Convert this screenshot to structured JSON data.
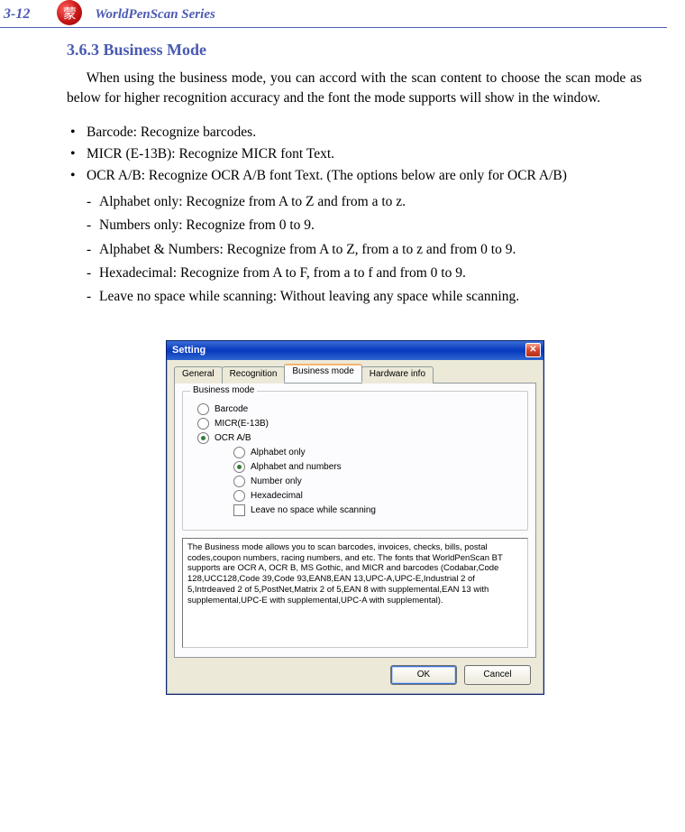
{
  "header": {
    "page_number": "3-12",
    "logo_glyph": "蒙",
    "series_title": "WorldPenScan Series"
  },
  "section": {
    "title": "3.6.3 Business Mode",
    "intro": "When using the business mode, you can accord with the scan content to choose the scan mode as below for higher recognition accuracy and the font the mode supports will show in the window.",
    "bullets": [
      "Barcode: Recognize barcodes.",
      "MICR (E-13B): Recognize MICR font Text.",
      "OCR A/B: Recognize OCR A/B font Text. (The options below are only for OCR A/B)"
    ],
    "sub_items": [
      "Alphabet only: Recognize from A to Z and from a to z.",
      "Numbers only:  Recognize from 0 to 9.",
      "Alphabet & Numbers: Recognize from A to Z, from a to z and from 0 to 9.",
      "Hexadecimal: Recognize from A to F, from a to f and from 0 to 9.",
      "Leave no space while scanning: Without leaving any space while scanning."
    ]
  },
  "dialog": {
    "title": "Setting",
    "close_glyph": "✕",
    "tabs": [
      "General",
      "Recognition",
      "Business mode",
      "Hardware info"
    ],
    "fieldset_legend": "Business mode",
    "radios_main": [
      {
        "label": "Barcode",
        "checked": false
      },
      {
        "label": "MICR(E-13B)",
        "checked": false
      },
      {
        "label": "OCR A/B",
        "checked": true
      }
    ],
    "radios_sub": [
      {
        "label": "Alphabet only",
        "checked": false
      },
      {
        "label": "Alphabet and numbers",
        "checked": true
      },
      {
        "label": "Number only",
        "checked": false
      },
      {
        "label": "Hexadecimal",
        "checked": false
      }
    ],
    "checkbox_sub": {
      "label": "Leave no space while scanning",
      "checked": false
    },
    "description": "The Business mode allows you to scan barcodes, invoices, checks, bills, postal codes,coupon numbers, racing numbers, and etc.  The fonts that WorldPenScan BT supports are OCR A, OCR B, MS Gothic, and MICR and  barcodes (Codabar,Code 128,UCC128,Code 39,Code 93,EAN8,EAN 13,UPC-A,UPC-E,Industrial 2 of 5,Intrdeaved 2 of 5,PostNet,Matrix 2 of 5,EAN 8 with supplemental,EAN 13 with supplemental,UPC-E with supplemental,UPC-A with supplemental).",
    "buttons": {
      "ok": "OK",
      "cancel": "Cancel"
    }
  }
}
